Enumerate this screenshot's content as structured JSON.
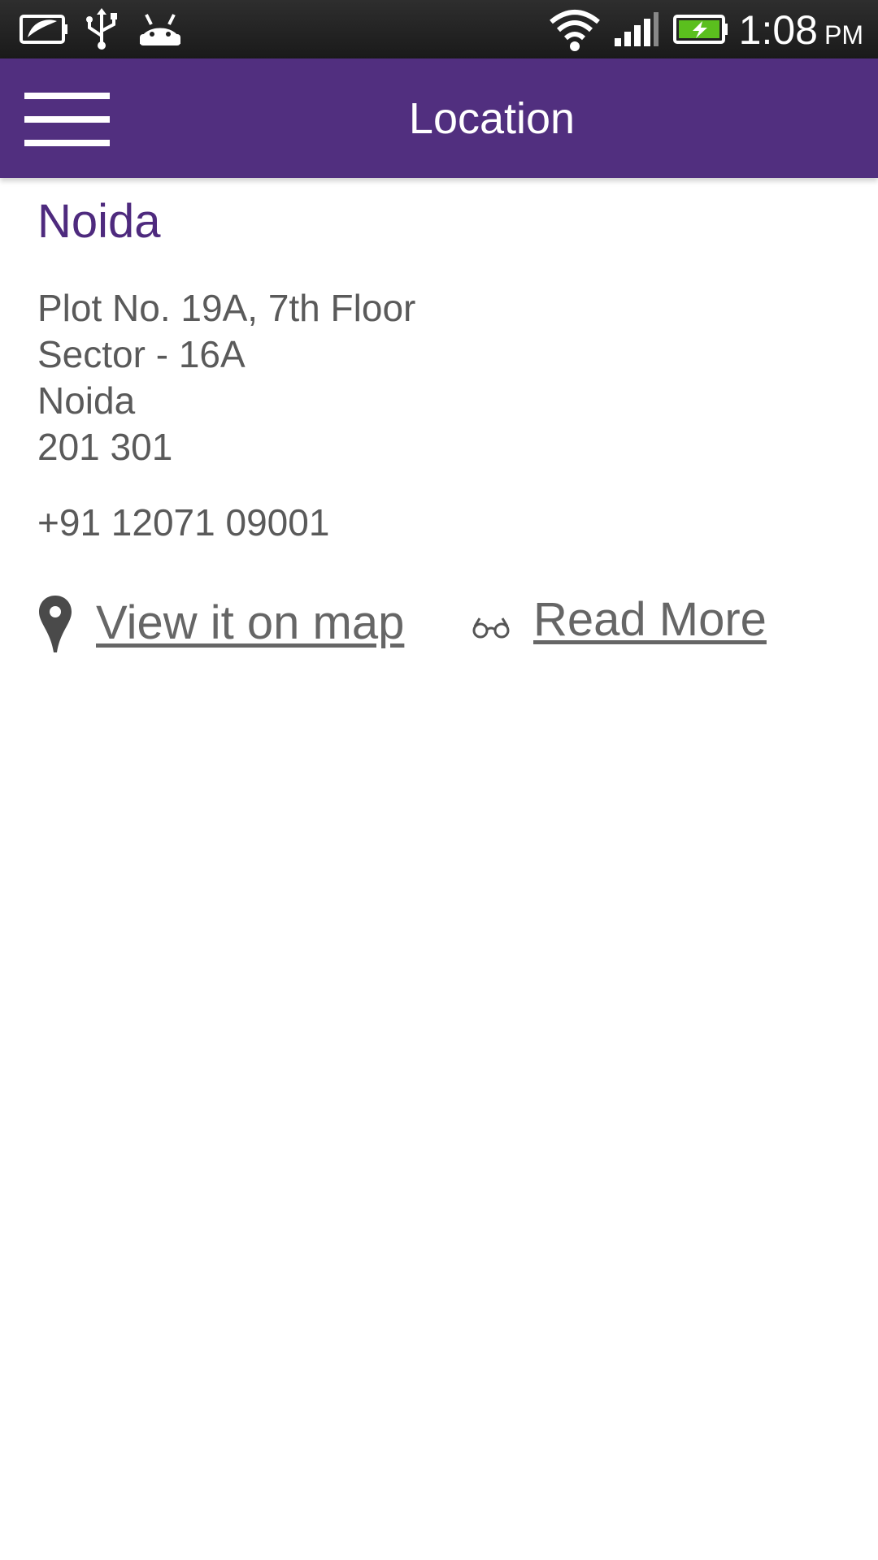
{
  "status_bar": {
    "time": "1:08",
    "ampm": "PM",
    "icons": [
      "power-saver-icon",
      "usb-icon",
      "android-icon",
      "wifi-icon",
      "signal-icon",
      "battery-charging-icon"
    ]
  },
  "app_bar": {
    "title": "Location",
    "menu_icon": "hamburger-menu-icon"
  },
  "location": {
    "city": "Noida",
    "address_lines": [
      "Plot No. 19A, 7th Floor",
      "Sector - 16A",
      "Noida",
      "201 301"
    ],
    "phone": "+91 12071 09001",
    "map_link_label": "View it on map",
    "map_icon": "map-pin-icon",
    "read_more_label": "Read More",
    "read_more_icon": "glasses-icon"
  },
  "colors": {
    "app_bar": "#512f7f",
    "title_text": "#4e2a7e",
    "body_text": "#5a5a5a",
    "battery": "#5bbf1e"
  }
}
